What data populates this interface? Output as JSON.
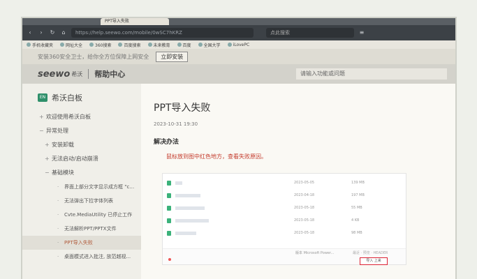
{
  "browser": {
    "tab_title": "PPT导入失败",
    "url": "https://help.seewo.com/mobile/0wSC7hKRZ",
    "search_placeholder": "点此搜索",
    "bookmarks": [
      "手机收藏夹",
      "网址大全",
      "360搜索",
      "百度搜索",
      "未来教育",
      "百度",
      "全国大学",
      "iLovePC"
    ]
  },
  "promo": {
    "text": "安装360安全卫士，给你全方位保障上网安全",
    "install_label": "立即安装"
  },
  "site": {
    "logo": "seewo",
    "logo_cn": "希沃",
    "help_center": "帮助中心",
    "search_placeholder": "请输入功能或问题"
  },
  "sidebar": {
    "brand": "希沃白板",
    "brand_badge": "EN",
    "items": [
      {
        "marker": "+",
        "label": "欢迎使用希沃白板"
      },
      {
        "marker": "−",
        "label": "异常处理"
      },
      {
        "marker": "+",
        "label": "安装卸载"
      },
      {
        "marker": "+",
        "label": "无法启动/启动崩溃"
      },
      {
        "marker": "−",
        "label": "基础模块"
      },
      {
        "marker": "·",
        "label": "界面上部分文字显示成方框 \"co..."
      },
      {
        "marker": "·",
        "label": "无法弹出下拉字体列表"
      },
      {
        "marker": "·",
        "label": "Cvte.MediaUtility 已停止工作"
      },
      {
        "marker": "·",
        "label": "无法解析PPT/PPTX文件"
      },
      {
        "marker": "·",
        "label": "PPT导入失败"
      },
      {
        "marker": "·",
        "label": "桌面模式进入批注, 放范越视..."
      }
    ]
  },
  "article": {
    "title": "PPT导入失败",
    "date": "2023-10-31 19:30",
    "section": "解决办法",
    "note": "鼠标放到图中红色地方，查看失败原因。",
    "files": [
      {
        "date": "2023-05-05",
        "size": "139 MB"
      },
      {
        "date": "2023-04-18",
        "size": "197 MB"
      },
      {
        "date": "2023-05-18",
        "size": "55 MB"
      },
      {
        "date": "2023-05-18",
        "size": "4 KB"
      },
      {
        "date": "2023-05-18",
        "size": "98 MB"
      }
    ],
    "footer_tag": "版本 Microsoft Power...",
    "footer_right": "最近 · 预览 · HEADER",
    "open_button": "导入 上来"
  }
}
